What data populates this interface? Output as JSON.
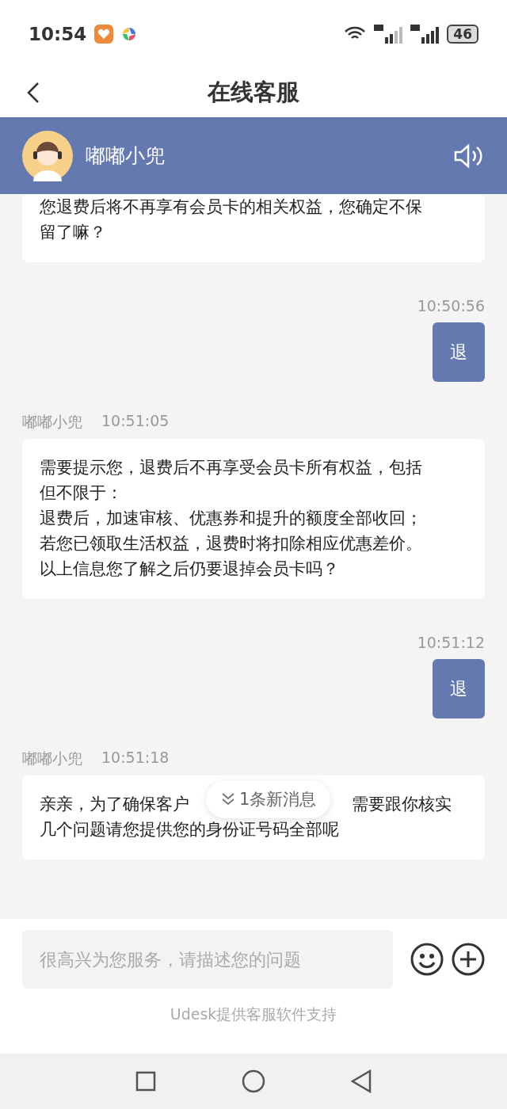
{
  "status_bar": {
    "time": "10:54",
    "battery": "46"
  },
  "title_bar": {
    "title": "在线客服"
  },
  "agent_header": {
    "name": "嘟嘟小兜"
  },
  "messages": [
    {
      "kind": "agent",
      "text": "您退费后将不再享有会员卡的相关权益，您确定不保留了嘛？"
    },
    {
      "kind": "user",
      "time": "10:50:56",
      "text": "退"
    },
    {
      "kind": "agent",
      "sender": "嘟嘟小兜",
      "time": "10:51:05",
      "paragraphs": [
        "需要提示您，退费后不再享受会员卡所有权益，包括但不限于：",
        "退费后，加速审核、优惠券和提升的额度全部收回；",
        "若您已领取生活权益，退费时将扣除相应优惠差价。",
        "以上信息您了解之后仍要退掉会员卡吗？"
      ]
    },
    {
      "kind": "user",
      "time": "10:51:12",
      "text": "退"
    },
    {
      "kind": "agent_covered",
      "sender": "嘟嘟小兜",
      "time": "10:51:18",
      "parts": [
        "亲亲，为了确保客户",
        "需要跟你核实"
      ],
      "text": "几个问题请您提供您的身份证号码全部呢"
    }
  ],
  "new_message_pill": {
    "text": "1条新消息"
  },
  "input": {
    "placeholder": "很高兴为您服务，请描述您的问题"
  },
  "footer": {
    "text": "Udesk提供客服软件支持"
  }
}
